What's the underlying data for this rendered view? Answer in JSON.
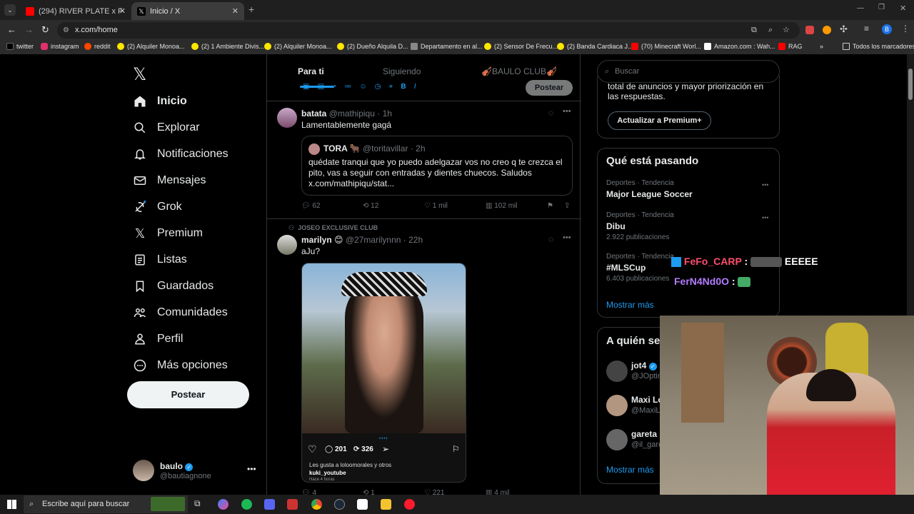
{
  "browser": {
    "tabs": [
      {
        "title": "(294) RIVER PLATE x FLAMENGO",
        "active": false
      },
      {
        "title": "Inicio / X",
        "active": true
      }
    ],
    "new_tab_symbol": "+",
    "url": "x.com/home",
    "bookmarks": [
      "twitter",
      "instagram",
      "reddit",
      "(2) Alquiler Monoa...",
      "(2) 1 Ambiente Divis...",
      "(2) Alquiler Monoa...",
      "(2) Dueño Alquila D...",
      "Departamento en al...",
      "(2) Sensor De Frecu...",
      "(2) Banda Cardiaca J...",
      "(70) Minecraft Worl...",
      "Amazon.com : Wah...",
      "RAG"
    ],
    "all_bookmarks": "Todos los marcadores",
    "profile_initial": "B"
  },
  "sidebar": {
    "items": [
      {
        "label": "Inicio",
        "icon": "home-icon",
        "bold": true
      },
      {
        "label": "Explorar",
        "icon": "search-icon"
      },
      {
        "label": "Notificaciones",
        "icon": "bell-icon"
      },
      {
        "label": "Mensajes",
        "icon": "mail-icon"
      },
      {
        "label": "Grok",
        "icon": "grok-icon"
      },
      {
        "label": "Premium",
        "icon": "x-logo-icon"
      },
      {
        "label": "Listas",
        "icon": "list-icon"
      },
      {
        "label": "Guardados",
        "icon": "bookmark-icon"
      },
      {
        "label": "Comunidades",
        "icon": "people-icon"
      },
      {
        "label": "Perfil",
        "icon": "person-icon"
      },
      {
        "label": "Más opciones",
        "icon": "more-circle-icon"
      }
    ],
    "post_button": "Postear",
    "account": {
      "name": "baulo",
      "handle": "@bautiagnone"
    }
  },
  "feed": {
    "tabs": [
      "Para ti",
      "Siguiendo",
      "🎻BAULO CLUB🎻"
    ],
    "composer_post": "Postear",
    "tweets": [
      {
        "name": "batata",
        "handle": "@mathipiqu",
        "time": "· 1h",
        "text": "Lamentablemente gagá",
        "quote": {
          "name": "TORA 🐂",
          "handle": "@toritavillar",
          "time": "· 2h",
          "text": "quédate tranqui que yo puedo adelgazar vos no creo q te crezca el pito, vas a seguir con entradas y dientes chuecos. Saludos x.com/mathipiqu/stat..."
        },
        "stats": {
          "replies": "62",
          "reposts": "12",
          "likes": "1 mil",
          "views": "102 mil"
        }
      },
      {
        "context": "JOSEO EXCLUSIVE CLUB",
        "name": "marilyn 😊",
        "handle": "@27marilynnn",
        "time": "· 22h",
        "text": "aJu?",
        "media": {
          "comments": "201",
          "reposts": "326",
          "likes_text": "Les gusta a loloomorales y otros",
          "user": "kuki_youtube",
          "time": "Hace 4 horas"
        },
        "stats": {
          "replies": "4",
          "reposts": "1",
          "likes": "221",
          "views": "4 mil"
        }
      }
    ]
  },
  "right": {
    "search_placeholder": "Buscar",
    "premium_text": "total de anuncios y mayor priorización en las respuestas.",
    "premium_button": "Actualizar a Premium+",
    "trends_title": "Qué está pasando",
    "trends": [
      {
        "meta": "Deportes · Tendencia",
        "name": "Major League Soccer",
        "count": ""
      },
      {
        "meta": "Deportes · Tendencia",
        "name": "Dibu",
        "count": "2.922 publicaciones"
      },
      {
        "meta": "Deportes · Tendencia",
        "name": "#MLSCup",
        "count": "6.403 publicaciones"
      }
    ],
    "show_more": "Mostrar más",
    "follow_title": "A quién seguir",
    "follow": [
      {
        "name": "jot4",
        "handle": "@JOptimista"
      },
      {
        "name": "Maxi Lopez",
        "handle": "@MaxiLopez"
      },
      {
        "name": "gareta",
        "handle": "@il_gareta"
      }
    ],
    "show_more2": "Mostrar más"
  },
  "overlay_chat": [
    {
      "user": "FeFo_CARP",
      "msg": "EEEEE"
    },
    {
      "user": "FerN4Nd0O",
      "msg": ""
    }
  ],
  "taskbar": {
    "search_placeholder": "Escribe aquí para buscar"
  }
}
